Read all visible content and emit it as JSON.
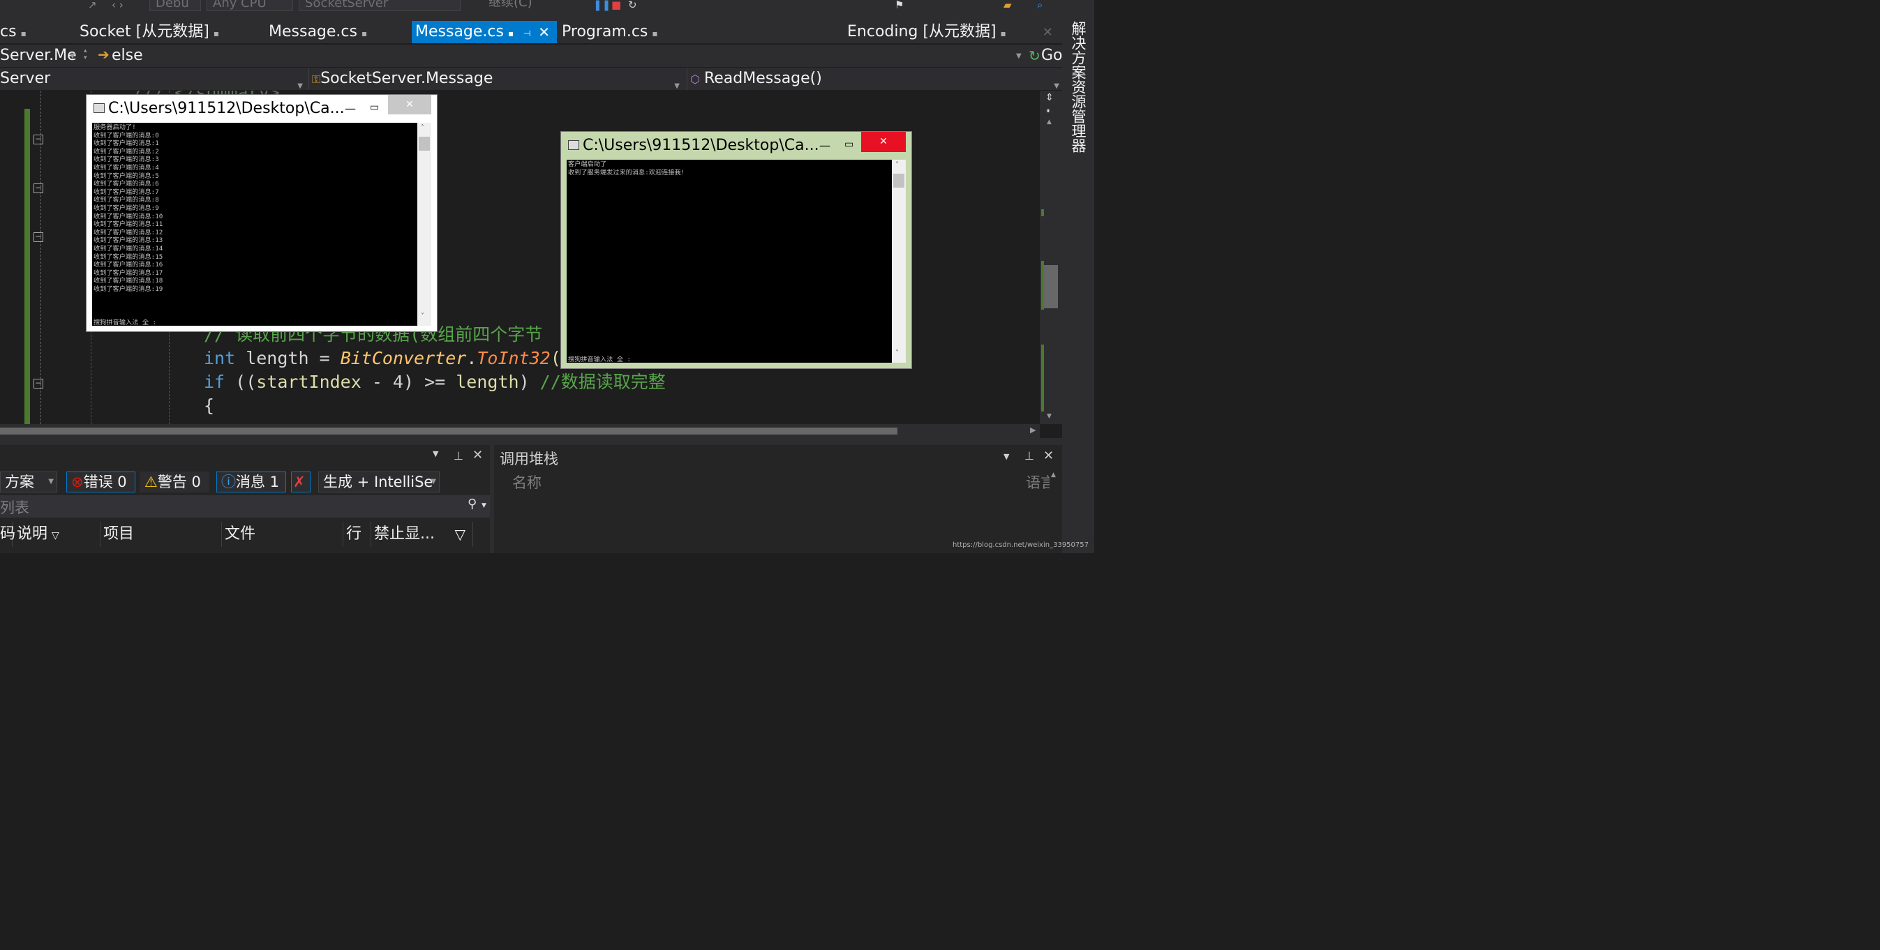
{
  "toolbar": {
    "config": "Debu",
    "platform": "Any CPU",
    "project": "SocketServer",
    "continue_label": "继续(C)"
  },
  "tabs": [
    {
      "label": "cs"
    },
    {
      "label": "Socket [从元数据]"
    },
    {
      "label": "Message.cs"
    },
    {
      "label": "Message.cs"
    },
    {
      "label": "Program.cs"
    },
    {
      "label": "Encoding [从元数据]"
    }
  ],
  "nav1": {
    "left": "Server.Me",
    "middle": "else",
    "go": "Go"
  },
  "nav2": {
    "left": "Server",
    "class": "SocketServer.Message",
    "method": "ReadMessage()"
  },
  "code": {
    "summary": "/// </summary>",
    "comment1": "// 读取前四个字节的数据(数组前四个字节",
    "l2_kw": "int",
    "l2_var": " length ",
    "l2_eq": "= ",
    "l2_cls": "BitConverter",
    "l2_dot": ".",
    "l2_mth": "ToInt32",
    "l2_rest": "(dat",
    "l3_kw": "if",
    "l3_a": " ((",
    "l3_var": "startIndex",
    "l3_b": " - 4) >= ",
    "l3_var2": "length",
    "l3_c": ") ",
    "l3_cm": "//数据读取完整",
    "l4": "{"
  },
  "server_window": {
    "title": "C:\\Users\\911512\\Desktop\\Ca...",
    "lines": [
      "服务器启动了!",
      "收到了客户端的消息:0",
      "收到了客户端的消息:1",
      "收到了客户端的消息:2",
      "收到了客户端的消息:3",
      "收到了客户端的消息:4",
      "收到了客户端的消息:5",
      "收到了客户端的消息:6",
      "收到了客户端的消息:7",
      "收到了客户端的消息:8",
      "收到了客户端的消息:9",
      "收到了客户端的消息:10",
      "收到了客户端的消息:11",
      "收到了客户端的消息:12",
      "收到了客户端的消息:13",
      "收到了客户端的消息:14",
      "收到了客户端的消息:15",
      "收到了客户端的消息:16",
      "收到了客户端的消息:17",
      "收到了客户端的消息:18",
      "收到了客户端的消息:19"
    ],
    "ime": "搜狗拼音输入法 全 :"
  },
  "client_window": {
    "title": "C:\\Users\\911512\\Desktop\\Ca...",
    "lines": [
      "客户端启动了",
      "收到了服务端发过来的消息:欢迎连接我!"
    ],
    "ime": "搜狗拼音输入法 全 :"
  },
  "error_list": {
    "scope": "方案",
    "errors": "错误 0",
    "warnings": "警告 0",
    "messages": "消息 1",
    "build_filter": "生成 + IntelliSe",
    "search_placeholder": "列表",
    "columns": [
      "码",
      "说明",
      "项目",
      "文件",
      "行",
      "禁止显..."
    ]
  },
  "call_stack": {
    "title": "调用堆栈",
    "col_name": "名称",
    "col_lang": "语言"
  },
  "side_panel": {
    "label": "解决方案资源管理器"
  },
  "watermark": "https://blog.csdn.net/weixin_33950757",
  "colors": {
    "accent": "#007acc",
    "client_frame": "#c4d7ad",
    "close_red": "#e81123"
  }
}
